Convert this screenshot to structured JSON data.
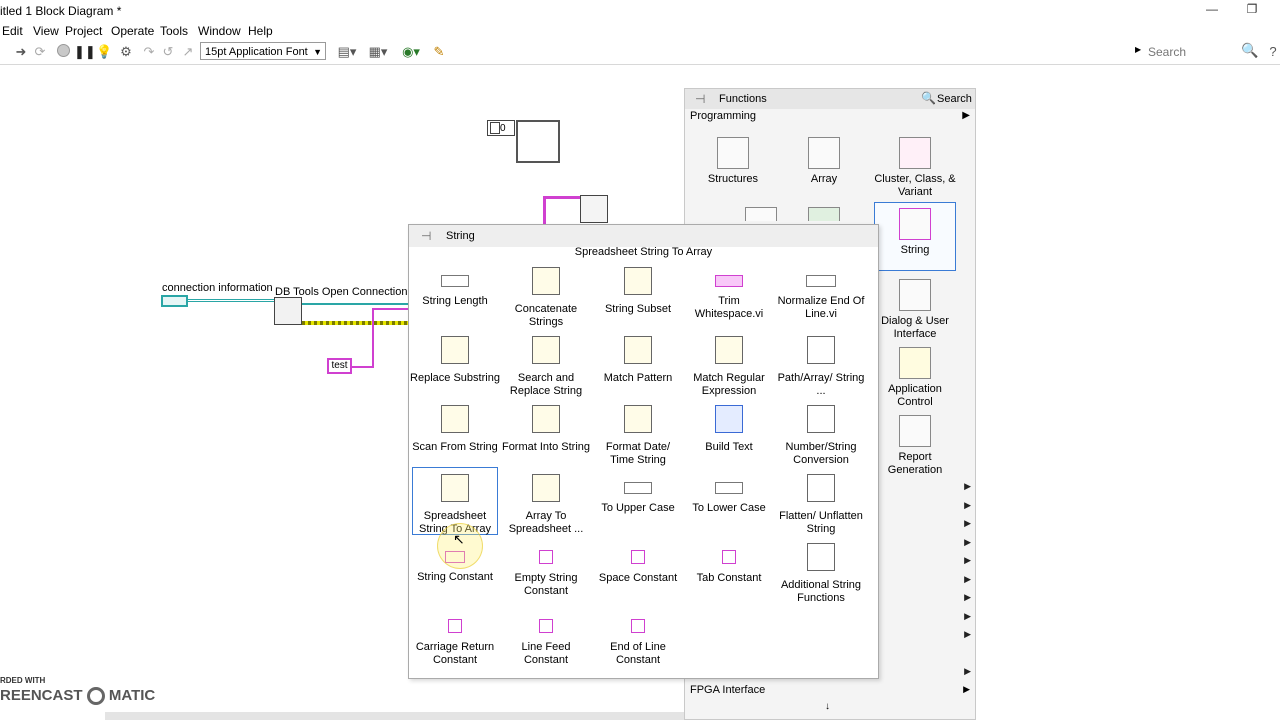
{
  "window": {
    "title": "itled 1 Block Diagram *"
  },
  "menu": [
    "Edit",
    "View",
    "Project",
    "Operate",
    "Tools",
    "Window",
    "Help"
  ],
  "toolbar": {
    "font": "15pt Application Font",
    "search_placeholder": "Search"
  },
  "diagram": {
    "numeric_constant": "0",
    "connection_label": "connection information",
    "db_label": "DB Tools Open Connection.vi",
    "string_constant": "test"
  },
  "functions_palette": {
    "title": "Functions",
    "search": "Search",
    "section": "Programming",
    "items": [
      "Structures",
      "Array",
      "Cluster, Class, & Variant",
      "String",
      "Dialog & User Interface",
      "Application Control",
      "Report Generation"
    ],
    "bottom": "FPGA Interface"
  },
  "string_palette": {
    "title": "String",
    "hover_name": "Spreadsheet String To Array",
    "items": [
      "String Length",
      "Concatenate Strings",
      "String Subset",
      "Trim Whitespace.vi",
      "Normalize End Of Line.vi",
      "Replace Substring",
      "Search and Replace String",
      "Match Pattern",
      "Match Regular Expression",
      "Path/Array/ String ...",
      "Scan From String",
      "Format Into String",
      "Format Date/ Time String",
      "Build Text",
      "Number/String Conversion",
      "Spreadsheet String To Array",
      "Array To Spreadsheet ...",
      "To Upper Case",
      "To Lower Case",
      "Flatten/ Unflatten String",
      "String Constant",
      "Empty String Constant",
      "Space Constant",
      "Tab Constant",
      "Additional String Functions",
      "Carriage Return Constant",
      "Line Feed Constant",
      "End of Line Constant"
    ]
  },
  "watermark": {
    "top": "RDED WITH",
    "brand_left": "REENCAST",
    "brand_right": "MATIC"
  }
}
